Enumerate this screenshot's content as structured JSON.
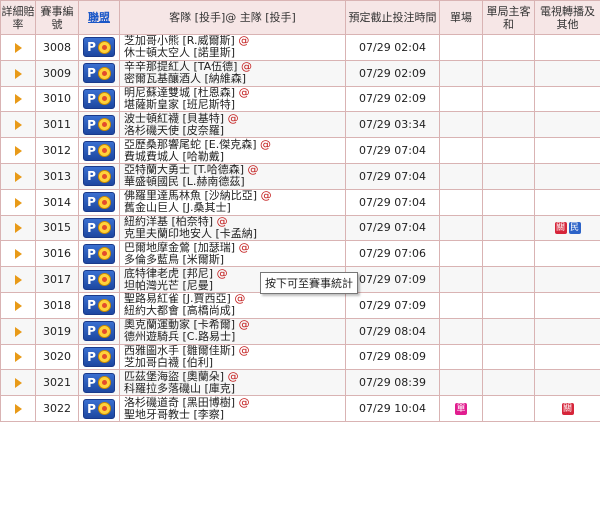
{
  "headers": {
    "detail": "詳細賠率",
    "match_no": "賽事編號",
    "league": "聯盟",
    "teams": "客隊 [投手]@ 主隊 [投手]",
    "time": "預定截止投注時間",
    "single": "單場",
    "first_half": "單局主客和",
    "tv": "電視轉播及其他"
  },
  "tooltip": "按下可至賽事統計",
  "at_symbol": "@",
  "rows": [
    {
      "no": "3008",
      "away": "芝加哥小熊 [R.威爾斯]",
      "home": "休士頓太空人 [諾里斯]",
      "time": "07/29 02:04",
      "single": "",
      "tv": []
    },
    {
      "no": "3009",
      "away": "辛辛那提紅人 [TA伍德]",
      "home": "密爾瓦基釀酒人 [納維森]",
      "time": "07/29 02:09",
      "single": "",
      "tv": []
    },
    {
      "no": "3010",
      "away": "明尼蘇達雙城 [杜恩森]",
      "home": "堪薩斯皇家 [班尼斯特]",
      "time": "07/29 02:09",
      "single": "",
      "tv": []
    },
    {
      "no": "3011",
      "away": "波士頓紅襪 [貝基特]",
      "home": "洛杉磯天使 [皮奈羅]",
      "time": "07/29 03:34",
      "single": "",
      "tv": []
    },
    {
      "no": "3012",
      "away": "亞歷桑那響尾蛇 [E.傑克森]",
      "home": "費城費城人 [哈勒戴]",
      "time": "07/29 07:04",
      "single": "",
      "tv": []
    },
    {
      "no": "3013",
      "away": "亞特蘭大勇士 [T.哈德森]",
      "home": "華盛頓國民 [L.赫南德茲]",
      "time": "07/29 07:04",
      "single": "",
      "tv": []
    },
    {
      "no": "3014",
      "away": "佛羅里達馬林魚 [沙納比亞]",
      "home": "舊金山巨人 [J.桑其士]",
      "time": "07/29 07:04",
      "single": "",
      "tv": []
    },
    {
      "no": "3015",
      "away": "紐約洋基 [柏奈特]",
      "home": "克里夫蘭印地安人 [卡孟納]",
      "time": "07/29 07:04",
      "single": "",
      "tv": [
        {
          "t": "關",
          "c": "red"
        },
        {
          "t": "民",
          "c": "blue"
        }
      ]
    },
    {
      "no": "3016",
      "away": "巴爾地摩金鶯 [加瑟瑞]",
      "home": "多倫多藍鳥 [米爾斯]",
      "time": "07/29 07:06",
      "single": "",
      "tv": []
    },
    {
      "no": "3017",
      "away": "底特律老虎 [邦尼]",
      "home": "坦帕灣光芒 [尼曼]",
      "time": "07/29 07:09",
      "single": "",
      "tv": []
    },
    {
      "no": "3018",
      "away": "聖路易紅雀 [J.賈西亞]",
      "home": "紐約大都會 [高橋尚成]",
      "time": "07/29 07:09",
      "single": "",
      "tv": []
    },
    {
      "no": "3019",
      "away": "奧克蘭運動家 [卡希爾]",
      "home": "德州遊騎兵 [C.路易士]",
      "time": "07/29 08:04",
      "single": "",
      "tv": []
    },
    {
      "no": "3020",
      "away": "西雅圖水手 [雛爾佳斯]",
      "home": "芝加哥白襪 [伯利]",
      "time": "07/29 08:09",
      "single": "",
      "tv": []
    },
    {
      "no": "3021",
      "away": "匹茲堡海盜 [奧蘭朵]",
      "home": "科羅拉多落磯山 [庫克]",
      "time": "07/29 08:39",
      "single": "",
      "tv": []
    },
    {
      "no": "3022",
      "away": "洛杉磯道奇 [黑田博樹]",
      "home": "聖地牙哥教士 [李察]",
      "time": "07/29 10:04",
      "single": "單",
      "tv": [
        {
          "t": "關",
          "c": "red"
        }
      ]
    }
  ]
}
